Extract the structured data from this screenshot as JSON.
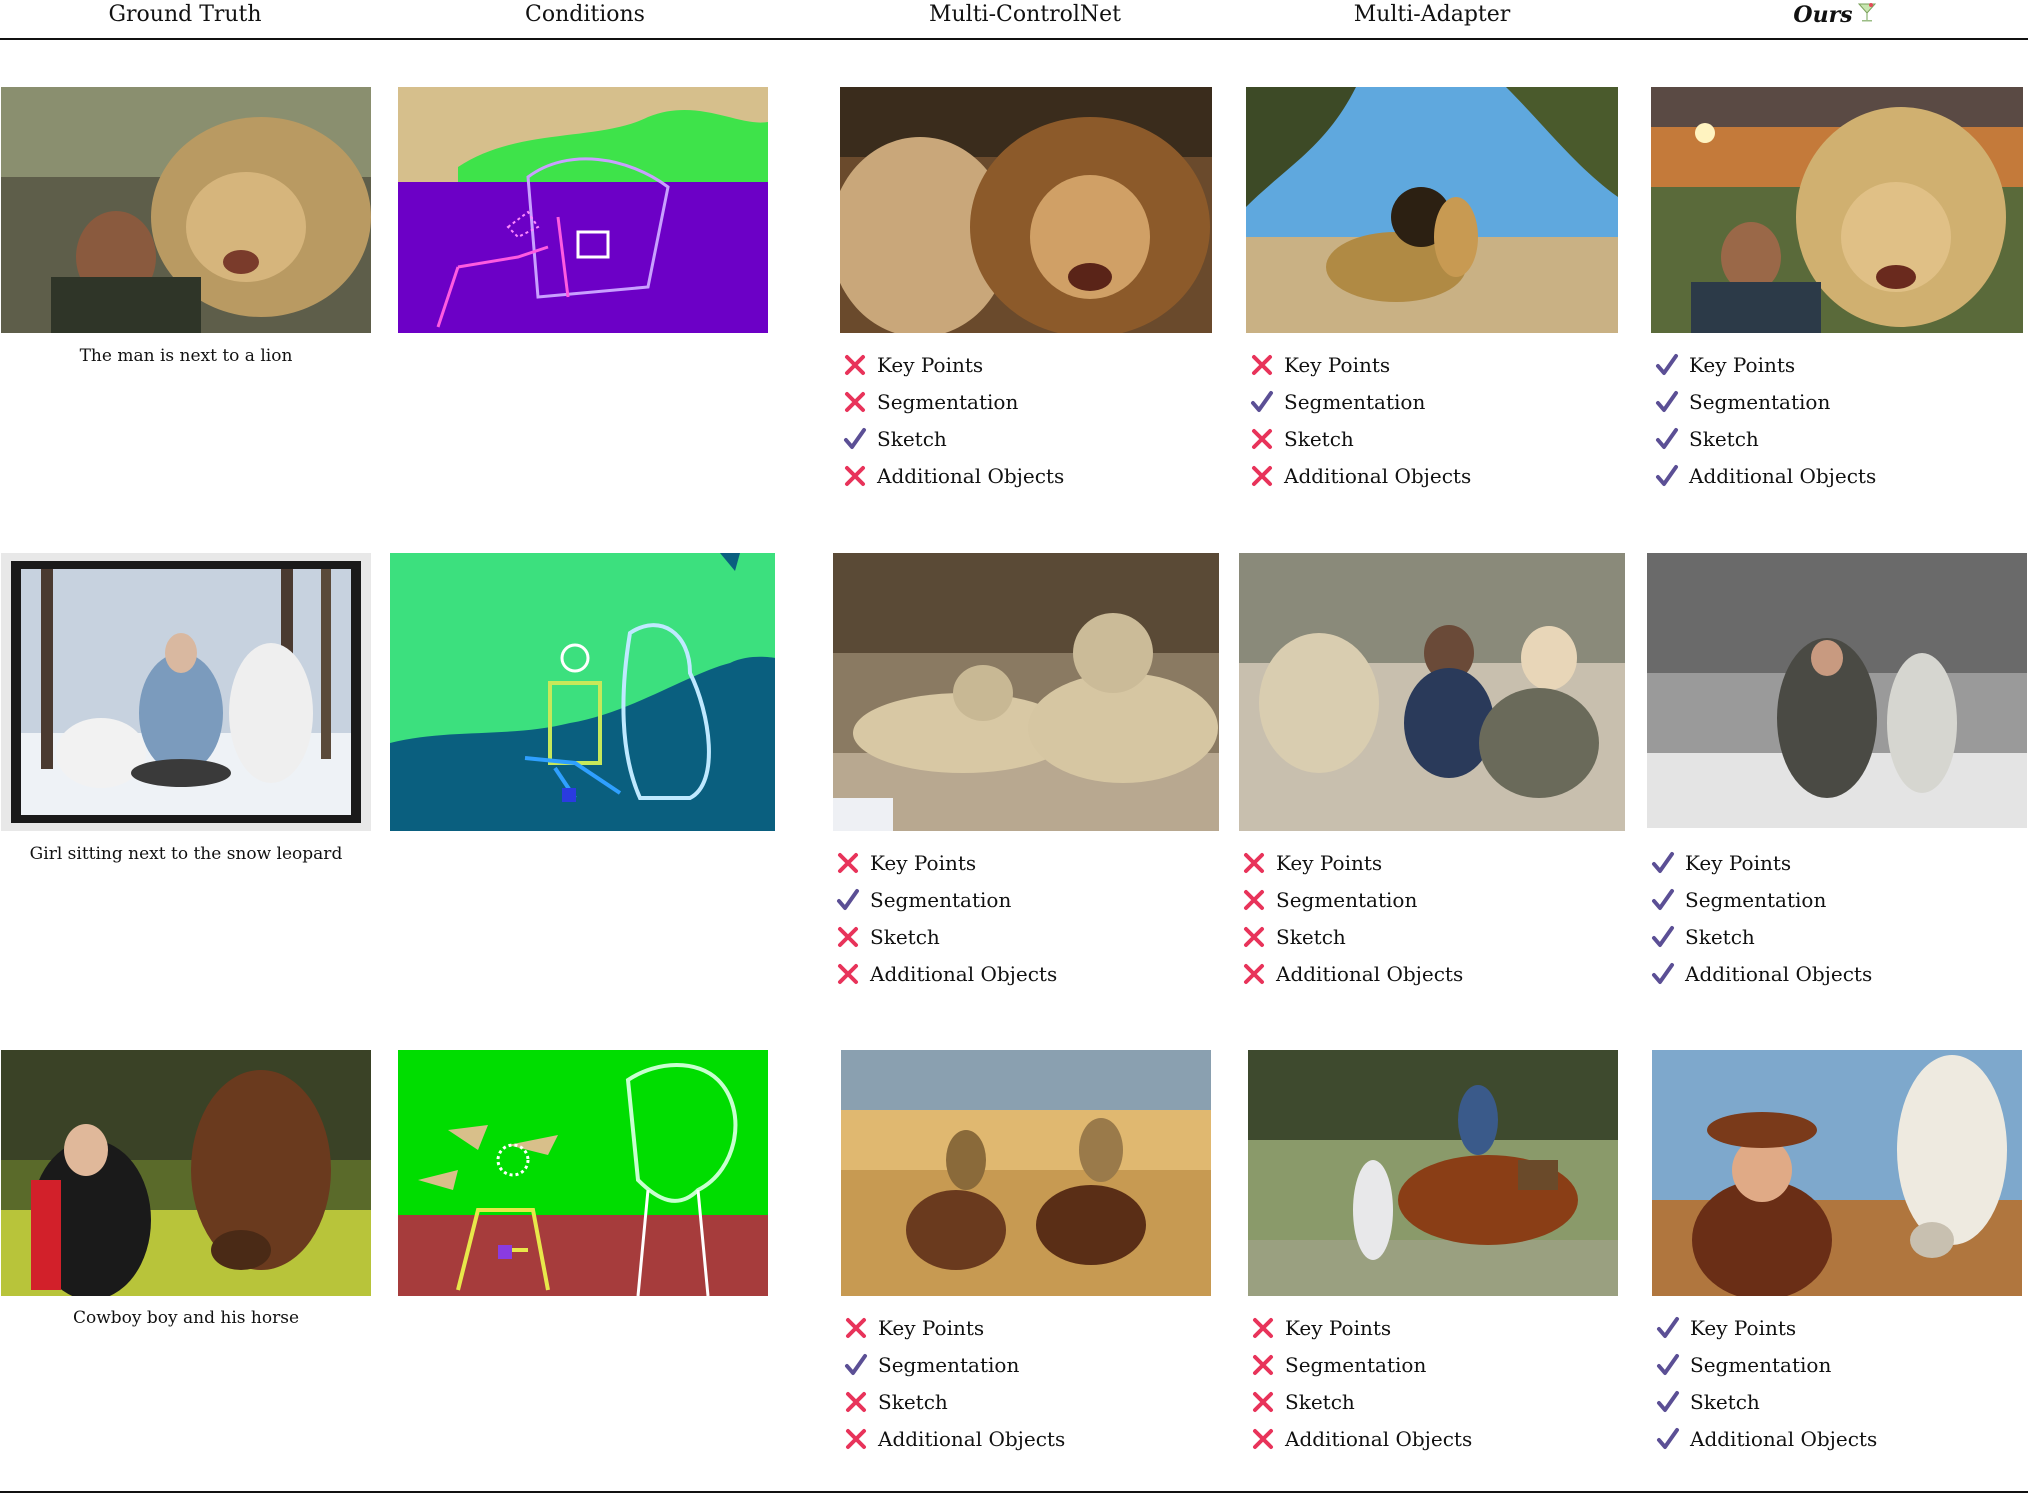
{
  "header": {
    "columns": [
      "Ground Truth",
      "Conditions",
      "Multi-ControlNet",
      "Multi-Adapter",
      "Ours"
    ],
    "ours_icon": "cocktail-icon"
  },
  "colors": {
    "cross": "#e8335a",
    "check": "#5b4f95"
  },
  "criteria": [
    "Key Points",
    "Segmentation",
    "Sketch",
    "Additional Objects"
  ],
  "rows": [
    {
      "caption": "The man is next to a lion",
      "results": [
        {
          "method": "Multi-ControlNet",
          "marks": [
            "cross",
            "cross",
            "check",
            "cross"
          ]
        },
        {
          "method": "Multi-Adapter",
          "marks": [
            "cross",
            "check",
            "cross",
            "cross"
          ]
        },
        {
          "method": "Ours",
          "marks": [
            "check",
            "check",
            "check",
            "check"
          ]
        }
      ]
    },
    {
      "caption": "Girl sitting next to the snow leopard",
      "results": [
        {
          "method": "Multi-ControlNet",
          "marks": [
            "cross",
            "check",
            "cross",
            "cross"
          ]
        },
        {
          "method": "Multi-Adapter",
          "marks": [
            "cross",
            "cross",
            "cross",
            "cross"
          ]
        },
        {
          "method": "Ours",
          "marks": [
            "check",
            "check",
            "check",
            "check"
          ]
        }
      ]
    },
    {
      "caption": "Cowboy boy and his horse",
      "results": [
        {
          "method": "Multi-ControlNet",
          "marks": [
            "cross",
            "check",
            "cross",
            "cross"
          ]
        },
        {
          "method": "Multi-Adapter",
          "marks": [
            "cross",
            "cross",
            "cross",
            "cross"
          ]
        },
        {
          "method": "Ours",
          "marks": [
            "check",
            "check",
            "check",
            "check"
          ]
        }
      ]
    }
  ]
}
